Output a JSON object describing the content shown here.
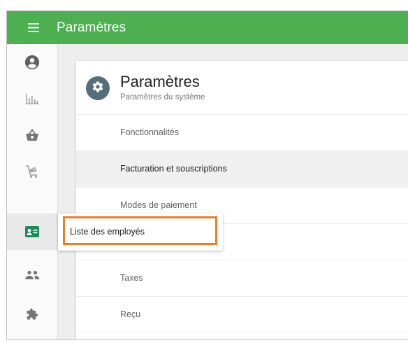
{
  "topbar": {
    "menu_icon": "hamburger-menu-icon",
    "title": "Paramètres",
    "background_color": "#4caf50"
  },
  "sidebar": {
    "items": [
      {
        "icon": "account-circle-icon",
        "name": "account"
      },
      {
        "icon": "bar-chart-icon",
        "name": "reports"
      },
      {
        "icon": "shopping-basket-icon",
        "name": "items"
      },
      {
        "icon": "inventory-cart-icon",
        "name": "inventory"
      },
      {
        "icon": "employee-badge-icon",
        "name": "employees",
        "active": true
      },
      {
        "icon": "customers-group-icon",
        "name": "customers"
      },
      {
        "icon": "puzzle-piece-icon",
        "name": "integrations"
      }
    ]
  },
  "settings_card": {
    "icon": "gear-icon",
    "title": "Paramètres",
    "subtitle": "Paramètres du système",
    "items": [
      {
        "label": "Fonctionnalités"
      },
      {
        "label": "Facturation et souscriptions",
        "selected": true
      },
      {
        "label": "Modes de paiement"
      },
      {
        "label": ""
      },
      {
        "label": "Taxes"
      },
      {
        "label": "Reçu"
      }
    ]
  },
  "tooltip": {
    "label": "Liste des employés",
    "highlight_color": "#ef7d22"
  }
}
